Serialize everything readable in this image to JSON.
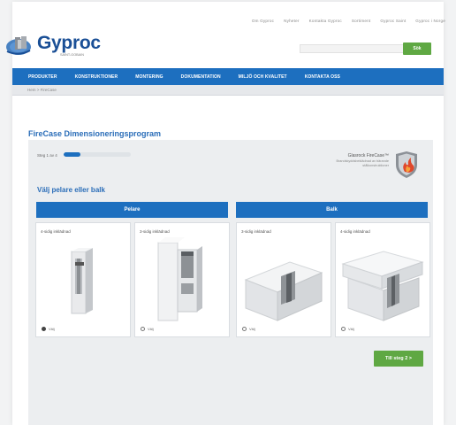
{
  "toplinks": [
    "Om Gyproc",
    "Nyheter",
    "Kontakta Gyproc",
    "Sortiment",
    "Gyproc Saint",
    "Gyproc i Norge"
  ],
  "brand": {
    "name": "Gyproc",
    "tagline": "SAINT-GOBAIN"
  },
  "search": {
    "placeholder": "",
    "button": "Sök"
  },
  "nav": [
    "PRODUKTER",
    "KONSTRUKTIONER",
    "MONTERING",
    "DOKUMENTATION",
    "MILJÖ OCH KVALITET",
    "KONTAKTA OSS"
  ],
  "breadcrumb": "Hem > FireCase",
  "page_title": "FireCase Dimensioneringsprogram",
  "app": {
    "progress_label": "Steg 1 av 4",
    "progress_value": 0.25,
    "promo_title": "Glasrock FireCase™",
    "promo_desc": "Brandskyddsbeklädnad av bärande stålkonstruktioner",
    "section_title": "Välj pelare eller balk",
    "columns": [
      {
        "header": "Pelare",
        "cards": [
          {
            "label": "4-sidig inklädnad",
            "radio": "Välj",
            "selected": true
          },
          {
            "label": "3-sidig inklädnad",
            "radio": "Välj",
            "selected": false
          }
        ]
      },
      {
        "header": "Balk",
        "cards": [
          {
            "label": "3-sidig inklädnad",
            "radio": "Välj",
            "selected": false
          },
          {
            "label": "4-sidig inklädnad",
            "radio": "Välj",
            "selected": false
          }
        ]
      }
    ],
    "next_button": "Till steg 2 >"
  },
  "colors": {
    "accent": "#1d6fbf",
    "action": "#5fa843",
    "brand": "#1a4f96"
  }
}
